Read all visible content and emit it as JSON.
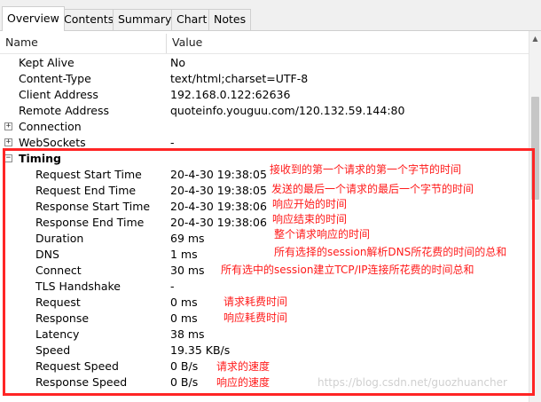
{
  "tabs": [
    {
      "label": "Overview",
      "active": true
    },
    {
      "label": "Contents",
      "active": false
    },
    {
      "label": "Summary",
      "active": false
    },
    {
      "label": "Chart",
      "active": false
    },
    {
      "label": "Notes",
      "active": false
    }
  ],
  "columns": {
    "name": "Name",
    "value": "Value"
  },
  "rows": {
    "kept_alive": {
      "name": "Kept Alive",
      "value": "No"
    },
    "content_type": {
      "name": "Content-Type",
      "value": "text/html;charset=UTF-8"
    },
    "client_address": {
      "name": "Client Address",
      "value": "192.168.0.122:62636"
    },
    "remote_address": {
      "name": "Remote Address",
      "value": "quoteinfo.youguu.com/120.132.59.144:80"
    },
    "connection": {
      "name": "Connection",
      "value": ""
    },
    "websockets": {
      "name": "WebSockets",
      "value": "-"
    },
    "timing": {
      "name": "Timing"
    },
    "request_start_time": {
      "name": "Request Start Time",
      "value": "20-4-30 19:38:05"
    },
    "request_end_time": {
      "name": "Request End Time",
      "value": "20-4-30 19:38:05"
    },
    "response_start_time": {
      "name": "Response Start Time",
      "value": "20-4-30 19:38:06"
    },
    "response_end_time": {
      "name": "Response End Time",
      "value": "20-4-30 19:38:06"
    },
    "duration": {
      "name": "Duration",
      "value": "69 ms"
    },
    "dns": {
      "name": "DNS",
      "value": "1 ms"
    },
    "connect": {
      "name": "Connect",
      "value": "30 ms"
    },
    "tls_handshake": {
      "name": "TLS Handshake",
      "value": "-"
    },
    "request": {
      "name": "Request",
      "value": "0 ms"
    },
    "response": {
      "name": "Response",
      "value": "0 ms"
    },
    "latency": {
      "name": "Latency",
      "value": "38 ms"
    },
    "speed": {
      "name": "Speed",
      "value": "19.35 KB/s"
    },
    "request_speed": {
      "name": "Request Speed",
      "value": "0 B/s"
    },
    "response_speed": {
      "name": "Response Speed",
      "value": "0 B/s"
    }
  },
  "annotations": {
    "request_start": "接收到的第一个请求的第一个字节的时间",
    "request_end": "发送的最后一个请求的最后一个字节的时间",
    "response_start": "响应开始的时间",
    "response_end": "响应结束的时间",
    "duration": "整个请求响应的时间",
    "dns": "所有选择的session解析DNS所花费的时间的总和",
    "connect": "所有选中的session建立TCP/IP连接所花费的时间总和",
    "request": "请求耗费时间",
    "response": "响应耗费时间",
    "request_speed": "请求的速度",
    "response_speed": "响应的速度"
  },
  "watermark": "https://blog.csdn.net/guozhuancher",
  "colors": {
    "annotation": "#ff1a1a",
    "highlight_box": "#ff2525"
  }
}
